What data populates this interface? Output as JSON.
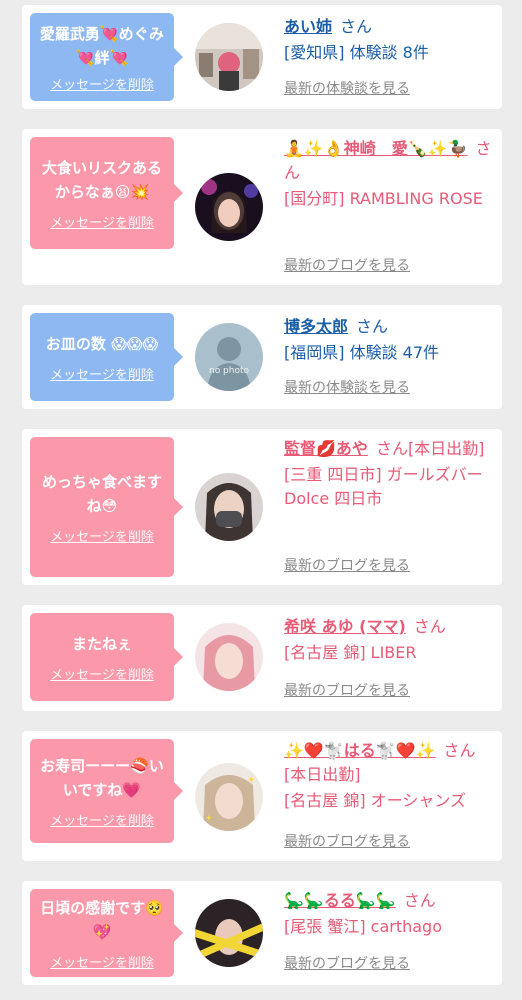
{
  "cards": [
    {
      "bubble_text": "愛羅武勇💘めぐみ💘絆💘",
      "delete_label": "メッセージを削除",
      "name": "あい姉",
      "suffix": "さん",
      "detail": "[愛知県] 体験談 8件",
      "latest_label": "最新の体験談を見る",
      "avatar": "photo-of-person-red-hair"
    },
    {
      "bubble_text": "大食いリスクあるからなぁ😫💥",
      "delete_label": "メッセージを削除",
      "name": "🧘✨👌神崎　愛🍾✨🦆",
      "suffix": "さん",
      "detail": "[国分町] RAMBLING ROSE",
      "latest_label": "最新のブログを見る",
      "avatar": "photo-of-woman-pink-glow"
    },
    {
      "bubble_text": "お皿の数 😱😱😱",
      "delete_label": "メッセージを削除",
      "name": "博多太郎",
      "suffix": "さん",
      "detail": "[福岡県] 体験談 47件",
      "latest_label": "最新の体験談を見る",
      "avatar": "no-photo-silhouette",
      "avatar_caption": "no photo"
    },
    {
      "bubble_text": "めっちゃ食べますね😳",
      "delete_label": "メッセージを削除",
      "name": "監督💋あや",
      "suffix": "さん[本日出勤]",
      "detail": "[三重 四日市] ガールズバー Dolce 四日市",
      "latest_label": "最新のブログを見る",
      "avatar": "photo-of-woman-with-mask"
    },
    {
      "bubble_text": "またねぇ",
      "delete_label": "メッセージを削除",
      "name": "希咲 あゆ (ママ)",
      "suffix": "さん",
      "detail": "[名古屋 錦] LIBER",
      "latest_label": "最新のブログを見る",
      "avatar": "photo-of-woman-pink-hair"
    },
    {
      "bubble_text": "お寿司ーーー🍣いいですね💗",
      "delete_label": "メッセージを削除",
      "name": "✨❤️🐩はる🐩❤️✨",
      "suffix": "さん[本日出勤]",
      "detail": "[名古屋 錦] オーシャンズ",
      "latest_label": "最新のブログを見る",
      "avatar": "photo-of-woman-with-stars"
    },
    {
      "bubble_text": "日頃の感謝です🥺💖",
      "delete_label": "メッセージを削除",
      "name": "🦕🦕るる🦕🦕",
      "suffix": "さん",
      "detail": "[尾張 蟹江] carthago",
      "latest_label": "最新のブログを見る",
      "avatar": "photo-of-woman-caution-tape"
    }
  ],
  "colors": {
    "blue_bubble": "#8eb8f2",
    "pink_bubble": "#fb98aa",
    "blue_text": "#1b5ea8",
    "pink_text": "#e85a76",
    "page_bg": "#ececec"
  }
}
